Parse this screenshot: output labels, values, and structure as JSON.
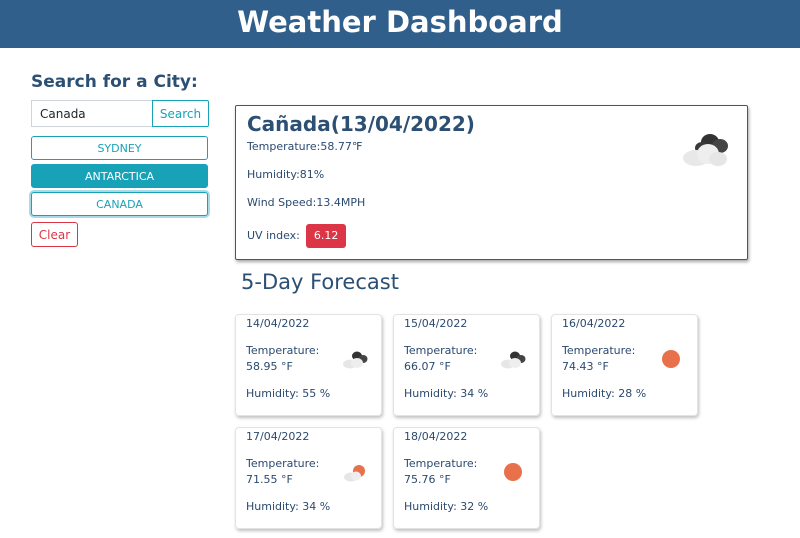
{
  "header": {
    "title": "Weather Dashboard"
  },
  "sidebar": {
    "title": "Search for a City:",
    "search_value": "Canada",
    "search_button": "Search",
    "history": [
      "SYDNEY",
      "ANTARCTICA",
      "CANADA"
    ],
    "clear_button": "Clear"
  },
  "current": {
    "title": "Cañada(13/04/2022)",
    "temperature": "Temperature:58.77℉",
    "humidity": "Humidity:81%",
    "wind": "Wind Speed:13.4MPH",
    "uv_label": "UV index:",
    "uv_value": "6.12",
    "icon": "broken-clouds-icon"
  },
  "forecast": {
    "heading": "5-Day Forecast",
    "days": [
      {
        "date": "14/04/2022",
        "temp_label": "Temperature:",
        "temp_value": "58.95 °F",
        "humidity": "Humidity: 55 %",
        "icon": "broken-clouds-icon"
      },
      {
        "date": "15/04/2022",
        "temp_label": "Temperature:",
        "temp_value": "66.07 °F",
        "humidity": "Humidity: 34 %",
        "icon": "broken-clouds-icon"
      },
      {
        "date": "16/04/2022",
        "temp_label": "Temperature:",
        "temp_value": "74.43 °F",
        "humidity": "Humidity: 28 %",
        "icon": "clear-sun-icon"
      },
      {
        "date": "17/04/2022",
        "temp_label": "Temperature:",
        "temp_value": "71.55 °F",
        "humidity": "Humidity: 34 %",
        "icon": "few-clouds-icon"
      },
      {
        "date": "18/04/2022",
        "temp_label": "Temperature:",
        "temp_value": "75.76 °F",
        "humidity": "Humidity: 32 %",
        "icon": "clear-sun-icon"
      }
    ]
  },
  "colors": {
    "header": "#2f5f8a",
    "accent": "#17a2b8",
    "danger": "#dc3545",
    "sun": "#e8704a"
  }
}
